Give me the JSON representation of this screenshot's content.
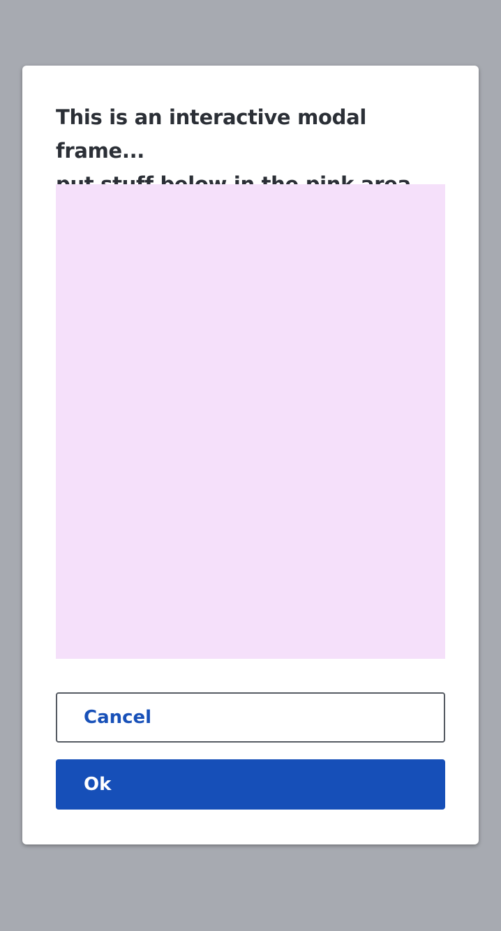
{
  "modal": {
    "title_line1": "This is an interactive modal frame...",
    "title_line2": "put stuff below in the pink area",
    "cancel_label": "Cancel",
    "ok_label": "Ok"
  },
  "colors": {
    "backdrop": "#a7aab1",
    "modal_background": "#ffffff",
    "content_area": "#f5e0fa",
    "primary": "#164fb8",
    "title_text": "#2b2f36"
  }
}
